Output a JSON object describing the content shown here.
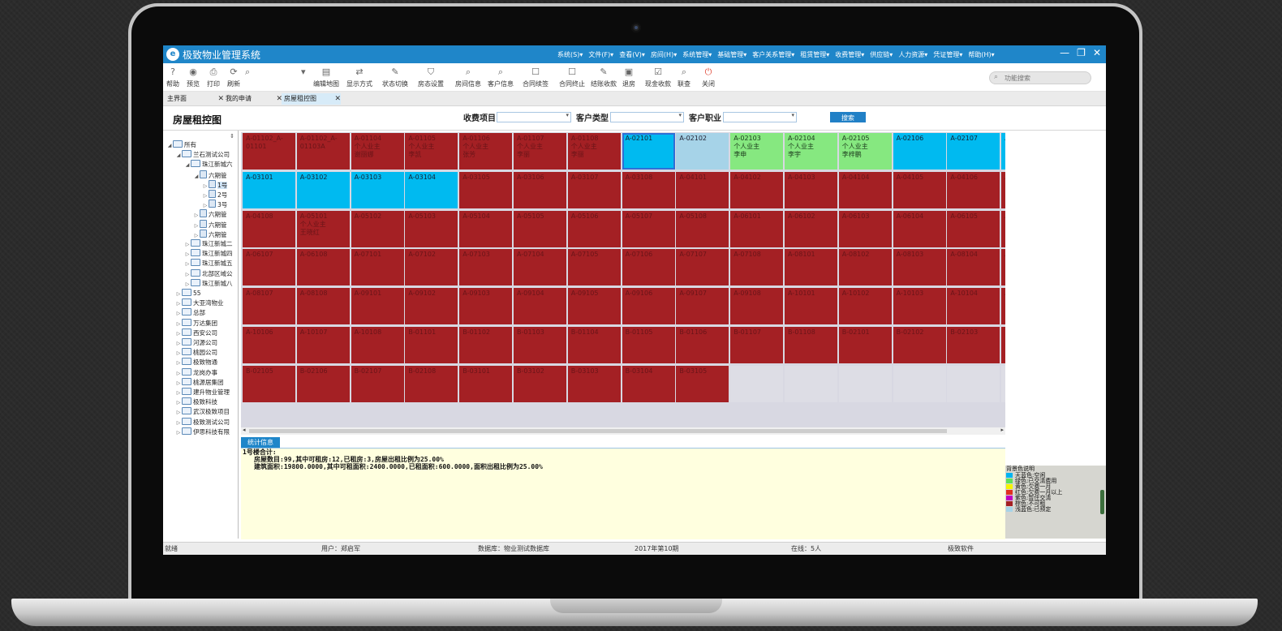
{
  "app": {
    "title": "极致物业管理系统",
    "logo_glyph": "e",
    "menus": [
      "系统(S)▾",
      "文件(F)▾",
      "查看(V)▾",
      "房间(H)▾",
      "系统管理▾",
      "基础管理▾",
      "客户关系管理▾",
      "租赁管理▾",
      "收费管理▾",
      "供应链▾",
      "人力资源▾",
      "凭证管理▾",
      "帮助(H)▾"
    ],
    "window_controls": [
      "—",
      "❐",
      "✕"
    ]
  },
  "toolbar": {
    "buttons": [
      {
        "label": "帮助",
        "icon": "question-icon",
        "glyph": "?"
      },
      {
        "label": "预览",
        "icon": "eye-icon",
        "glyph": "◉"
      },
      {
        "label": "打印",
        "icon": "printer-icon",
        "glyph": "⎙"
      },
      {
        "label": "刷新",
        "icon": "refresh-icon",
        "glyph": "⟳"
      },
      {
        "label": "",
        "icon": "search-icon",
        "glyph": "⌕"
      },
      {
        "label": "",
        "icon": "dropdown-icon",
        "glyph": "▾"
      },
      {
        "label": "编辑地图",
        "icon": "edit-map-icon",
        "glyph": "▤"
      },
      {
        "label": "显示方式",
        "icon": "display-mode-icon",
        "glyph": "⇄"
      },
      {
        "label": "状态切换",
        "icon": "status-switch-icon",
        "glyph": "✎"
      },
      {
        "label": "房态设置",
        "icon": "room-status-icon",
        "glyph": "⛉"
      },
      {
        "label": "房间信息",
        "icon": "room-info-icon",
        "glyph": "⌕"
      },
      {
        "label": "客户信息",
        "icon": "customer-info-icon",
        "glyph": "⌕"
      },
      {
        "label": "合同续签",
        "icon": "contract-renew-icon",
        "glyph": "☐"
      },
      {
        "label": "合同终止",
        "icon": "contract-end-icon",
        "glyph": "☐"
      },
      {
        "label": "结账收款",
        "icon": "checkout-icon",
        "glyph": "✎"
      },
      {
        "label": "退房",
        "icon": "checkout-room-icon",
        "glyph": "▣"
      },
      {
        "label": "现金收款",
        "icon": "cash-icon",
        "glyph": "☑"
      },
      {
        "label": "联查",
        "icon": "linked-query-icon",
        "glyph": "⌕"
      },
      {
        "label": "关闭",
        "icon": "power-icon",
        "glyph": "⏻"
      }
    ],
    "function_search_placeholder": "功能搜索"
  },
  "tabs": [
    {
      "label": "主界面",
      "close": "✕"
    },
    {
      "label": "我的申请",
      "close": "✕"
    },
    {
      "label": "房屋租控图",
      "close": "✕"
    }
  ],
  "page": {
    "title": "房屋租控图",
    "filters": [
      {
        "label": "收费项目",
        "value": ""
      },
      {
        "label": "客户类型",
        "value": ""
      },
      {
        "label": "客户职业",
        "value": ""
      }
    ],
    "search_label": "搜索",
    "dropdown_arrow": "▾"
  },
  "tree": {
    "pin": "⇕",
    "nodes": [
      {
        "label": "所有",
        "level": 0,
        "toggle": "◢",
        "type": "folder"
      },
      {
        "label": "兰石测试公司",
        "level": 1,
        "toggle": "◢",
        "type": "folder"
      },
      {
        "label": "珠江新城六",
        "level": 2,
        "toggle": "◢",
        "type": "folder"
      },
      {
        "label": "六期管",
        "level": 3,
        "toggle": "◢",
        "type": "doc"
      },
      {
        "label": "1号",
        "level": 4,
        "toggle": "▷",
        "type": "doc",
        "selected": true
      },
      {
        "label": "2号",
        "level": 4,
        "toggle": "▷",
        "type": "doc"
      },
      {
        "label": "3号",
        "level": 4,
        "toggle": "▷",
        "type": "doc"
      },
      {
        "label": "六期管",
        "level": 3,
        "toggle": "▷",
        "type": "doc"
      },
      {
        "label": "六期管",
        "level": 3,
        "toggle": "▷",
        "type": "doc"
      },
      {
        "label": "六期管",
        "level": 3,
        "toggle": "▷",
        "type": "doc"
      },
      {
        "label": "珠江新城二",
        "level": 2,
        "toggle": "▷",
        "type": "folder"
      },
      {
        "label": "珠江新城四",
        "level": 2,
        "toggle": "▷",
        "type": "folder"
      },
      {
        "label": "珠江新城五",
        "level": 2,
        "toggle": "▷",
        "type": "folder"
      },
      {
        "label": "北部区域公",
        "level": 2,
        "toggle": "▷",
        "type": "folder"
      },
      {
        "label": "珠江新城八",
        "level": 2,
        "toggle": "▷",
        "type": "folder"
      },
      {
        "label": "55",
        "level": 1,
        "toggle": "▷",
        "type": "folder"
      },
      {
        "label": "大亚湾物业",
        "level": 1,
        "toggle": "▷",
        "type": "folder"
      },
      {
        "label": "总部",
        "level": 1,
        "toggle": "▷",
        "type": "folder"
      },
      {
        "label": "万达集团",
        "level": 1,
        "toggle": "▷",
        "type": "folder"
      },
      {
        "label": "西安公司",
        "level": 1,
        "toggle": "▷",
        "type": "folder"
      },
      {
        "label": "河源公司",
        "level": 1,
        "toggle": "▷",
        "type": "folder"
      },
      {
        "label": "桃园公司",
        "level": 1,
        "toggle": "▷",
        "type": "folder"
      },
      {
        "label": "极致物通",
        "level": 1,
        "toggle": "▷",
        "type": "folder"
      },
      {
        "label": "龙岗办事",
        "level": 1,
        "toggle": "▷",
        "type": "folder"
      },
      {
        "label": "桃源居集团",
        "level": 1,
        "toggle": "▷",
        "type": "folder"
      },
      {
        "label": "建升物业管理",
        "level": 1,
        "toggle": "▷",
        "type": "folder"
      },
      {
        "label": "极致科技",
        "level": 1,
        "toggle": "▷",
        "type": "folder"
      },
      {
        "label": "武汉极致项目",
        "level": 1,
        "toggle": "▷",
        "type": "folder"
      },
      {
        "label": "极致测试公司",
        "level": 1,
        "toggle": "▷",
        "type": "folder"
      },
      {
        "label": "伊思科技有限",
        "level": 1,
        "toggle": "▷",
        "type": "folder"
      }
    ]
  },
  "rooms": [
    [
      {
        "code": "A-01102_A-01101",
        "status": "red"
      },
      {
        "code": "A-01102_A-01103A",
        "status": "red"
      },
      {
        "code": "A-01104",
        "status": "red",
        "line2": "个人业主",
        "line3": "谢丽娜"
      },
      {
        "code": "A-01105",
        "status": "red",
        "line2": "个人业主",
        "line3": "李凯"
      },
      {
        "code": "A-01106",
        "status": "red",
        "line2": "个人业主",
        "line3": "张芳"
      },
      {
        "code": "A-01107",
        "status": "red",
        "line2": "个人业主",
        "line3": "李丽"
      },
      {
        "code": "A-01108",
        "status": "red",
        "line2": "个人业主",
        "line3": "李丽"
      },
      {
        "code": "A-02101",
        "status": "blue",
        "selected": true
      },
      {
        "code": "A-02102",
        "status": "lblue"
      },
      {
        "code": "A-02103",
        "status": "green",
        "line2": "个人业主",
        "line3": "李申"
      },
      {
        "code": "A-02104",
        "status": "green",
        "line2": "个人业主",
        "line3": "李宇"
      },
      {
        "code": "A-02105",
        "status": "green",
        "line2": "个人业主",
        "line3": "李梓鹏"
      },
      {
        "code": "A-02106",
        "status": "blue"
      },
      {
        "code": "A-02107",
        "status": "blue"
      },
      {
        "code": "A",
        "status": "blue"
      }
    ],
    [
      {
        "code": "A-03101",
        "status": "blue"
      },
      {
        "code": "A-03102",
        "status": "blue"
      },
      {
        "code": "A-03103",
        "status": "blue"
      },
      {
        "code": "A-03104",
        "status": "blue"
      },
      {
        "code": "A-03105",
        "status": "red"
      },
      {
        "code": "A-03106",
        "status": "red"
      },
      {
        "code": "A-03107",
        "status": "red"
      },
      {
        "code": "A-03108",
        "status": "red"
      },
      {
        "code": "A-04101",
        "status": "red"
      },
      {
        "code": "A-04102",
        "status": "red"
      },
      {
        "code": "A-04103",
        "status": "red"
      },
      {
        "code": "A-04104",
        "status": "red"
      },
      {
        "code": "A-04105",
        "status": "red"
      },
      {
        "code": "A-04106",
        "status": "red"
      },
      {
        "code": "A",
        "status": "red"
      }
    ],
    [
      {
        "code": "A-04108",
        "status": "red"
      },
      {
        "code": "A-05101",
        "status": "red",
        "line2": "个人业主",
        "line3": "王晓红"
      },
      {
        "code": "A-05102",
        "status": "red"
      },
      {
        "code": "A-05103",
        "status": "red"
      },
      {
        "code": "A-05104",
        "status": "red"
      },
      {
        "code": "A-05105",
        "status": "red"
      },
      {
        "code": "A-05106",
        "status": "red"
      },
      {
        "code": "A-05107",
        "status": "red"
      },
      {
        "code": "A-05108",
        "status": "red"
      },
      {
        "code": "A-06101",
        "status": "red"
      },
      {
        "code": "A-06102",
        "status": "red"
      },
      {
        "code": "A-06103",
        "status": "red"
      },
      {
        "code": "A-06104",
        "status": "red"
      },
      {
        "code": "A-06105",
        "status": "red"
      },
      {
        "code": "A",
        "status": "red"
      }
    ],
    [
      {
        "code": "A-06107",
        "status": "red"
      },
      {
        "code": "A-06108",
        "status": "red"
      },
      {
        "code": "A-07101",
        "status": "red"
      },
      {
        "code": "A-07102",
        "status": "red"
      },
      {
        "code": "A-07103",
        "status": "red"
      },
      {
        "code": "A-07104",
        "status": "red"
      },
      {
        "code": "A-07105",
        "status": "red"
      },
      {
        "code": "A-07106",
        "status": "red"
      },
      {
        "code": "A-07107",
        "status": "red"
      },
      {
        "code": "A-07108",
        "status": "red"
      },
      {
        "code": "A-08101",
        "status": "red"
      },
      {
        "code": "A-08102",
        "status": "red"
      },
      {
        "code": "A-08103",
        "status": "red"
      },
      {
        "code": "A-08104",
        "status": "red"
      },
      {
        "code": "A",
        "status": "red"
      }
    ],
    [
      {
        "code": "A-08107",
        "status": "red"
      },
      {
        "code": "A-08108",
        "status": "red"
      },
      {
        "code": "A-09101",
        "status": "red"
      },
      {
        "code": "A-09102",
        "status": "red"
      },
      {
        "code": "A-09103",
        "status": "red"
      },
      {
        "code": "A-09104",
        "status": "red"
      },
      {
        "code": "A-09105",
        "status": "red"
      },
      {
        "code": "A-09106",
        "status": "red"
      },
      {
        "code": "A-09107",
        "status": "red"
      },
      {
        "code": "A-09108",
        "status": "red"
      },
      {
        "code": "A-10101",
        "status": "red"
      },
      {
        "code": "A-10102",
        "status": "red"
      },
      {
        "code": "A-10103",
        "status": "red"
      },
      {
        "code": "A-10104",
        "status": "red"
      },
      {
        "code": "A",
        "status": "red"
      }
    ],
    [
      {
        "code": "A-10106",
        "status": "red"
      },
      {
        "code": "A-10107",
        "status": "red"
      },
      {
        "code": "A-10108",
        "status": "red"
      },
      {
        "code": "B-01101",
        "status": "red"
      },
      {
        "code": "B-01102",
        "status": "red"
      },
      {
        "code": "B-01103",
        "status": "red"
      },
      {
        "code": "B-01104",
        "status": "red"
      },
      {
        "code": "B-01105",
        "status": "red"
      },
      {
        "code": "B-01106",
        "status": "red"
      },
      {
        "code": "B-01107",
        "status": "red"
      },
      {
        "code": "B-01108",
        "status": "red"
      },
      {
        "code": "B-02101",
        "status": "red"
      },
      {
        "code": "B-02102",
        "status": "red"
      },
      {
        "code": "B-02103",
        "status": "red"
      },
      {
        "code": "B",
        "status": "red"
      }
    ],
    [
      {
        "code": "B-02105",
        "status": "red"
      },
      {
        "code": "B-02106",
        "status": "red"
      },
      {
        "code": "B-02107",
        "status": "red"
      },
      {
        "code": "B-02108",
        "status": "red"
      },
      {
        "code": "B-03101",
        "status": "red"
      },
      {
        "code": "B-03102",
        "status": "red"
      },
      {
        "code": "B-03103",
        "status": "red"
      },
      {
        "code": "B-03104",
        "status": "red"
      },
      {
        "code": "B-03105",
        "status": "red"
      },
      {
        "code": "",
        "status": "empty"
      },
      {
        "code": "",
        "status": "empty"
      },
      {
        "code": "",
        "status": "empty"
      },
      {
        "code": "",
        "status": "empty"
      },
      {
        "code": "",
        "status": "empty"
      },
      {
        "code": "",
        "status": "empty"
      }
    ]
  ],
  "stats": {
    "tab_label": "统计信息",
    "line1": "1号楼合计:",
    "line2": "房屋数目:99,其中可租房:12,已租房:3,房屋出租比例为25.00%",
    "line3": "建筑面积:19800.0000,其中可租面积:2400.0000,已租面积:600.0000,面积出租比例为25.00%"
  },
  "legend": {
    "title": "背景色说明",
    "items": [
      {
        "label": "天蓝色:空闲",
        "color": "#00b4f0"
      },
      {
        "label": "绿色:已交清费用",
        "color": "#5ee05a"
      },
      {
        "label": "黄色:欠费一月",
        "color": "#f4f400"
      },
      {
        "label": "红色:欠费一月以上",
        "color": "#e03020"
      },
      {
        "label": "紫色:暂住交清",
        "color": "#c000c0"
      },
      {
        "label": "棕色:不可租",
        "color": "#a42024"
      },
      {
        "label": "浅蓝色:已预定",
        "color": "#a6d3e8"
      }
    ]
  },
  "statusbar": {
    "ready": "就绪",
    "user": "用户：郑启军",
    "database": "数据库：物业测试数据库",
    "period": "2017年第10期",
    "online": "在线：5人",
    "vendor": "极致软件"
  }
}
